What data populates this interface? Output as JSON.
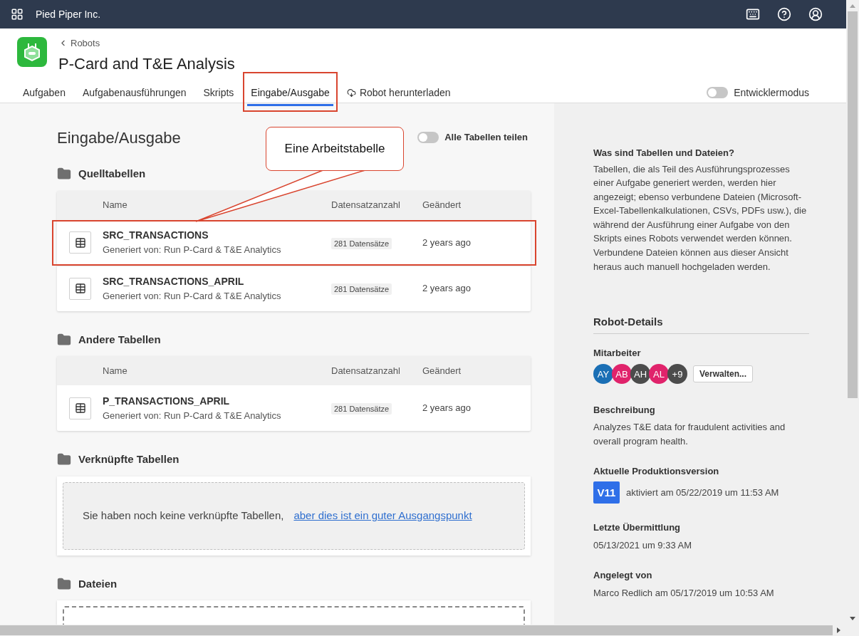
{
  "top_bar": {
    "org": "Pied Piper Inc."
  },
  "header": {
    "breadcrumb": "Robots",
    "title": "P-Card and T&E Analysis",
    "tabs": [
      {
        "label": "Aufgaben",
        "selected": false,
        "highlighted": false,
        "kind": "tab"
      },
      {
        "label": "Aufgabenausführungen",
        "selected": false,
        "highlighted": false,
        "kind": "tab"
      },
      {
        "label": "Skripts",
        "selected": false,
        "highlighted": false,
        "kind": "tab"
      },
      {
        "label": "Eingabe/Ausgabe",
        "selected": true,
        "highlighted": true,
        "kind": "tab"
      },
      {
        "label": "Robot herunterladen",
        "selected": false,
        "highlighted": false,
        "kind": "download"
      }
    ],
    "developer_mode": {
      "label": "Entwicklermodus",
      "on": false
    }
  },
  "main": {
    "title": "Eingabe/Ausgabe",
    "share_all": {
      "label": "Alle Tabellen teilen",
      "on": false
    },
    "callout": {
      "text": "Eine Arbeitstabelle"
    },
    "sections": [
      {
        "title": "Quelltabellen",
        "kind": "table",
        "columns": [
          "Name",
          "Datensatzanzahl",
          "Geändert"
        ],
        "rows": [
          {
            "name": "SRC_TRANSACTIONS",
            "generated": "Generiert von: Run P-Card & T&E Analytics",
            "count": "281 Datensätze",
            "changed": "2 years ago",
            "highlighted": true
          },
          {
            "name": "SRC_TRANSACTIONS_APRIL",
            "generated": "Generiert von: Run P-Card & T&E Analytics",
            "count": "281 Datensätze",
            "changed": "2 years ago",
            "highlighted": false
          }
        ]
      },
      {
        "title": "Andere Tabellen",
        "kind": "table",
        "columns": [
          "Name",
          "Datensatzanzahl",
          "Geändert"
        ],
        "rows": [
          {
            "name": "P_TRANSACTIONS_APRIL",
            "generated": "Generiert von: Run P-Card & T&E Analytics",
            "count": "281 Datensätze",
            "changed": "2 years ago",
            "highlighted": false
          }
        ]
      },
      {
        "title": "Verknüpfte Tabellen",
        "kind": "empty",
        "text": "Sie haben noch keine verknüpfte Tabellen,",
        "link": "aber dies ist ein guter Ausgangspunkt"
      },
      {
        "title": "Dateien",
        "kind": "dropzone"
      }
    ]
  },
  "sidebar": {
    "help_title": "Was sind Tabellen und Dateien?",
    "help_text": "Tabellen, die als Teil des Ausführungsprozesses einer Aufgabe generiert werden, werden hier angezeigt; ebenso verbundene Dateien (Microsoft-Excel-Tabellenkalkulationen, CSVs, PDFs usw.), die während der Ausführung einer Aufgabe von den Skripts eines Robots verwendet werden können. Verbundene Dateien können aus dieser Ansicht heraus auch manuell hochgeladen werden.",
    "details_title": "Robot-Details",
    "collaborators": {
      "label": "Mitarbeiter",
      "avatars": [
        {
          "initials": "AY",
          "color": "#1a6fb5"
        },
        {
          "initials": "AB",
          "color": "#e0236b"
        },
        {
          "initials": "AH",
          "color": "#4c4c4c"
        },
        {
          "initials": "AL",
          "color": "#e0236b"
        },
        {
          "initials": "+9",
          "color": "#4c4c4c"
        }
      ],
      "button": "Verwalten..."
    },
    "description": {
      "label": "Beschreibung",
      "text": "Analyzes T&E data for fraudulent activities and overall program health."
    },
    "version": {
      "label": "Aktuelle Produktionsversion",
      "badge": "V11",
      "text": "aktiviert am 05/22/2019 um 11:53 AM"
    },
    "last_commit": {
      "label": "Letzte Übermittlung",
      "text": "05/13/2021 um 9:33 AM"
    },
    "created_by": {
      "label": "Angelegt von",
      "text": "Marco Redlich am 05/17/2019 um 10:53 AM"
    }
  }
}
